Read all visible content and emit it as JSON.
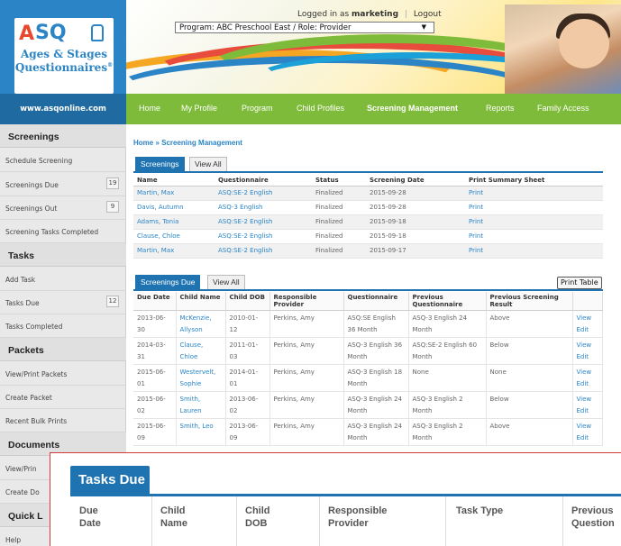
{
  "header": {
    "logo": {
      "a": "A",
      "sq": "SQ",
      "line1": "Ages & Stages",
      "line2": "Questionnaires",
      "reg": "®"
    },
    "login_prefix": "Logged in as",
    "login_user": "marketing",
    "logout": "Logout",
    "program_select": "Program: ABC Preschool East / Role: Provider",
    "site_url": "www.asqonline.com"
  },
  "nav": {
    "items": [
      {
        "label": "Home"
      },
      {
        "label": "My Profile"
      },
      {
        "label": "Program"
      },
      {
        "label": "Child Profiles"
      },
      {
        "label": "Screening Management"
      },
      {
        "label": "Reports"
      },
      {
        "label": "Family Access"
      }
    ],
    "active": "Screening Management"
  },
  "sidebar": {
    "sections": [
      {
        "title": "Screenings"
      },
      {
        "title": "Tasks"
      },
      {
        "title": "Packets"
      },
      {
        "title": "Documents"
      },
      {
        "title": "Quick L"
      }
    ],
    "items": [
      {
        "label": "Schedule Screening"
      },
      {
        "label": "Screenings Due",
        "badge": "19"
      },
      {
        "label": "Screenings Out",
        "badge": "9"
      },
      {
        "label": "Screening Tasks Completed"
      },
      {
        "label": "Add Task"
      },
      {
        "label": "Tasks Due",
        "badge": "12"
      },
      {
        "label": "Tasks Completed"
      },
      {
        "label": "View/Print Packets"
      },
      {
        "label": "Create Packet"
      },
      {
        "label": "Recent Bulk Prints"
      },
      {
        "label": "View/Prin"
      },
      {
        "label": "Create Do"
      },
      {
        "label": "Help"
      }
    ]
  },
  "breadcrumb": "Home » Screening Management",
  "screenings": {
    "tab_active": "Screenings",
    "tab_other": "View All",
    "headers": [
      "Name",
      "Questionnaire",
      "Status",
      "Screening Date",
      "Print Summary Sheet"
    ],
    "rows": [
      [
        "Martin, Max",
        "ASQ:SE-2 English",
        "Finalized",
        "2015-09-28",
        "Print"
      ],
      [
        "Davis, Autumn",
        "ASQ-3 English",
        "Finalized",
        "2015-09-28",
        "Print"
      ],
      [
        "Adams, Tonia",
        "ASQ:SE-2 English",
        "Finalized",
        "2015-09-18",
        "Print"
      ],
      [
        "Clause, Chloe",
        "ASQ:SE-2 English",
        "Finalized",
        "2015-09-18",
        "Print"
      ],
      [
        "Martin, Max",
        "ASQ:SE-2 English",
        "Finalized",
        "2015-09-17",
        "Print"
      ]
    ]
  },
  "screenings_due": {
    "tab_active": "Screenings Due",
    "tab_other": "View All",
    "print_table": "Print Table",
    "headers": [
      "Due Date",
      "Child Name",
      "Child DOB",
      "Responsible Provider",
      "Questionnaire",
      "Previous Questionnaire",
      "Previous Screening Result",
      ""
    ],
    "rows": [
      [
        "2013-06-30",
        "McKenzie, Allyson",
        "2010-01-12",
        "Perkins, Amy",
        "ASQ:SE English 36 Month",
        "ASQ-3 English 24 Month",
        "Above",
        "View",
        "Edit"
      ],
      [
        "2014-03-31",
        "Clause, Chloe",
        "2011-01-03",
        "Perkins, Amy",
        "ASQ-3 English 36 Month",
        "ASQ:SE-2 English 60 Month",
        "Below",
        "View",
        "Edit"
      ],
      [
        "2015-06-01",
        "Westervelt, Sophie",
        "2014-01-01",
        "Perkins, Amy",
        "ASQ-3 English 18 Month",
        "None",
        "None",
        "View",
        "Edit"
      ],
      [
        "2015-06-02",
        "Smith, Lauren",
        "2013-06-02",
        "Perkins, Amy",
        "ASQ-3 English 24 Month",
        "ASQ-3 English 2 Month",
        "Below",
        "View",
        "Edit"
      ],
      [
        "2015-06-09",
        "Smith, Leo",
        "2013-06-09",
        "Perkins, Amy",
        "ASQ-3 English 24 Month",
        "ASQ-3 English 2 Month",
        "Above",
        "View",
        "Edit"
      ]
    ]
  },
  "zoom": {
    "tab": "Tasks Due",
    "headers": [
      "Due\nDate",
      "Child\nName",
      "Child\nDOB",
      "Responsible\nProvider",
      "Task Type",
      "Previous\nQuestion"
    ]
  },
  "colors": {
    "brand_blue": "#1e73b0",
    "nav_green": "#7fbb3a",
    "link_blue": "#2a84c6",
    "zoom_border": "#d83a3a"
  }
}
